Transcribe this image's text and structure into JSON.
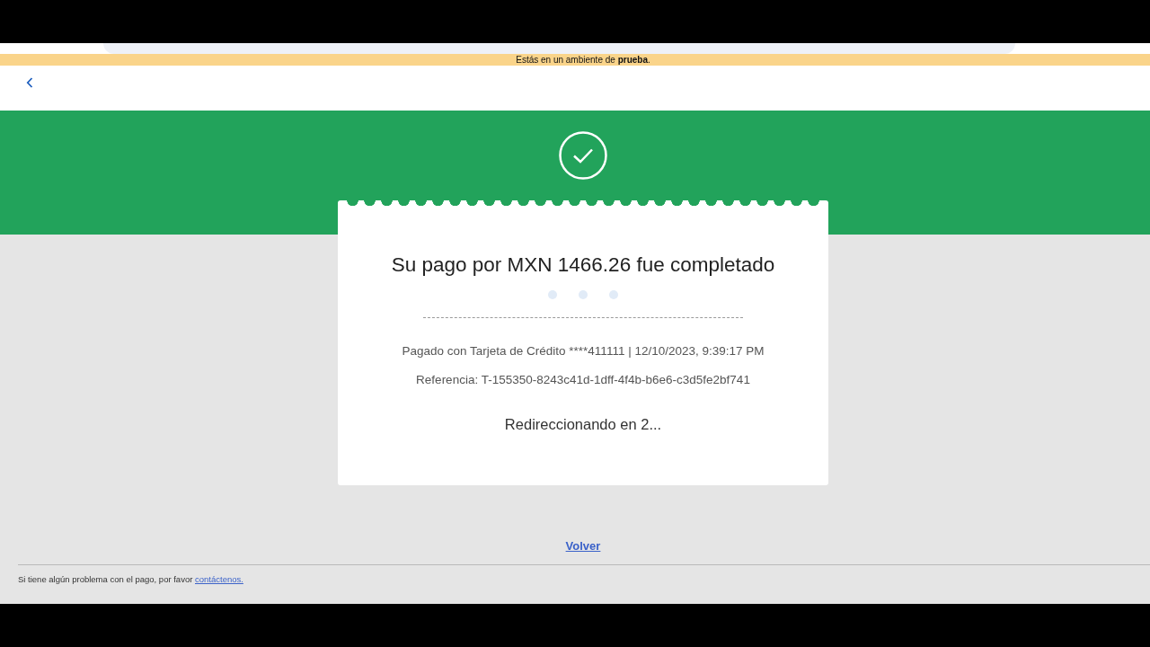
{
  "top_banner": {
    "text": "Estás en un ambiente de **prueba**."
  },
  "payment": {
    "title": "Su pago por MXN 1466.26 fue completado",
    "details": "Pagado con Tarjeta de Crédito ****411111 | 12/10/2023, 9:39:17 PM",
    "reference": "Referencia: T-155350-8243c41d-1dff-4f4b-b6e6-c3d5fe2bf741",
    "redirect": "Redireccionando en 2..."
  },
  "back_link": {
    "label": "Volver"
  },
  "footer": {
    "text": "Si tiene algún problema con el pago, por favor",
    "link": "contáctenos."
  }
}
